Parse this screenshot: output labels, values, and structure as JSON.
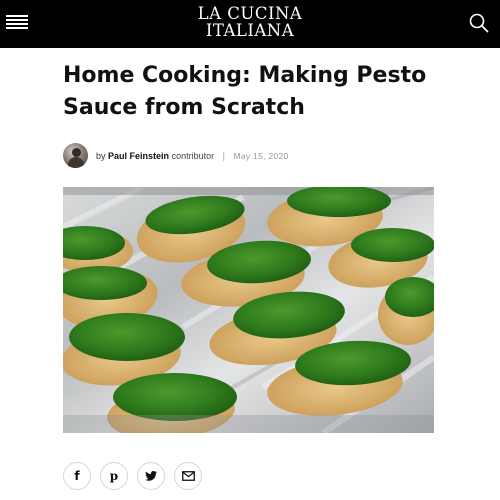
{
  "header": {
    "brand_line1": "LA CUCINA",
    "brand_line2": "ITALIANA",
    "menu_icon": "hamburger-menu-icon",
    "search_icon": "search-icon",
    "background": "#000000",
    "foreground": "#ffffff"
  },
  "article": {
    "title": "Home Cooking: Making Pesto Sauce from Scratch",
    "byline": {
      "by": "by",
      "author": "Paul Feinstein",
      "role": "contributor",
      "separator": "|",
      "date": "May 15, 2020"
    },
    "photo": {
      "subject": "toasted baguette slices topped with pesto on a foil-lined baking tray"
    }
  },
  "share": [
    {
      "icon": "facebook-icon",
      "glyph": "f"
    },
    {
      "icon": "pinterest-icon",
      "glyph": "p"
    },
    {
      "icon": "twitter-icon",
      "glyph": ""
    },
    {
      "icon": "email-icon",
      "glyph": ""
    }
  ]
}
